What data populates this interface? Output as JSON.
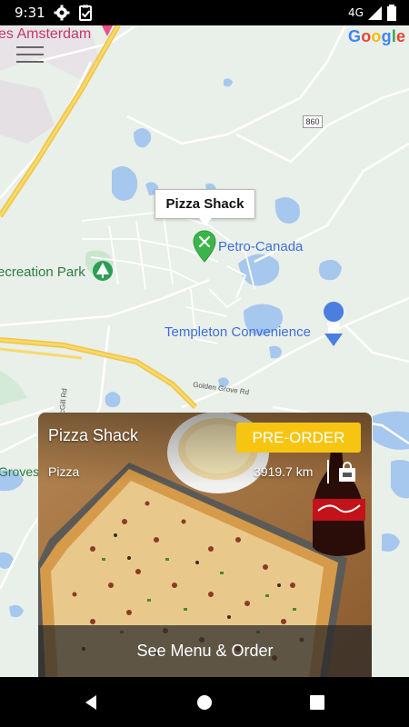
{
  "status_bar": {
    "time": "9:31",
    "network": "4G",
    "icons": [
      "settings-icon",
      "clipboard-icon",
      "signal-icon",
      "battery-icon"
    ]
  },
  "map": {
    "provider_logo": [
      "G",
      "o",
      "o",
      "g",
      "l",
      "e"
    ],
    "logo_colors": [
      "#4285F4",
      "#EA4335",
      "#FBBC05",
      "#4285F4",
      "#34A853",
      "#EA4335"
    ],
    "labels": {
      "town": "es Amsterdam",
      "park": "ecreation Park",
      "groves": "Groves",
      "petro": "Petro-Canada",
      "templeton": "Templeton Convenience",
      "route": "860",
      "golden_grove": "Golden Grove Rd",
      "mcgill": "McGill Rd"
    },
    "selected_pin_label": "Pizza Shack",
    "colors": {
      "land": "#e9efe9",
      "water": "#a6c8ee",
      "road": "#ffffff",
      "highway": "#f5d35c",
      "pin": "#3bb54a"
    }
  },
  "card": {
    "title": "Pizza Shack",
    "category": "Pizza",
    "distance": "3919.7 km",
    "preorder_label": "PRE-ORDER",
    "action_label": "See Menu & Order",
    "accent_color": "#f6c512"
  },
  "nav_bar": {
    "buttons": [
      "back-icon",
      "home-icon",
      "recents-icon"
    ]
  }
}
